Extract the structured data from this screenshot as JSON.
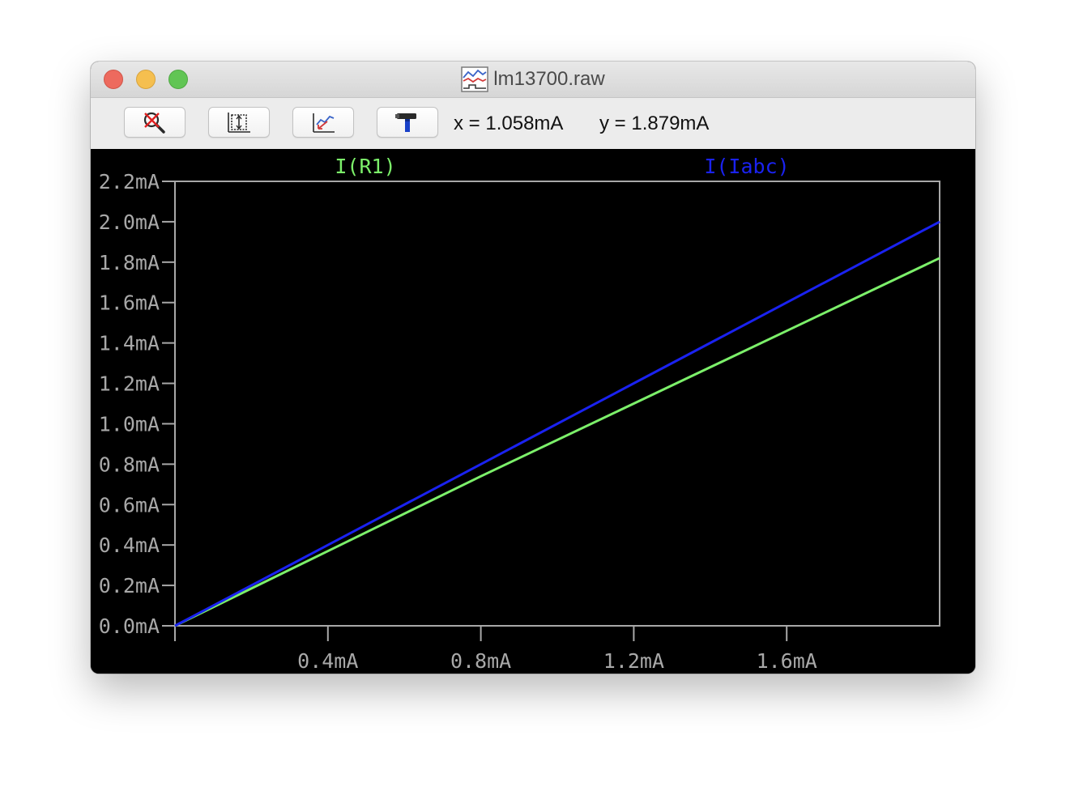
{
  "window": {
    "title": "lm13700.raw",
    "title_icon": "waveform-plot-icon"
  },
  "toolbar": {
    "buttons": [
      {
        "icon": "zoom-cancel-icon"
      },
      {
        "icon": "autorange-icon"
      },
      {
        "icon": "pan-icon"
      },
      {
        "icon": "settings-hammer-icon"
      }
    ],
    "cursor_x": "x = 1.058mA",
    "cursor_y": "y = 1.879mA"
  },
  "chart_data": {
    "type": "line",
    "title": "",
    "xlabel": "",
    "ylabel": "",
    "xlim": [
      0,
      2.0
    ],
    "ylim": [
      0,
      2.2
    ],
    "x_ticks": [
      "0.4mA",
      "0.8mA",
      "1.2mA",
      "1.6mA"
    ],
    "x_tick_values": [
      0.4,
      0.8,
      1.2,
      1.6
    ],
    "y_ticks": [
      "0.0mA",
      "0.2mA",
      "0.4mA",
      "0.6mA",
      "0.8mA",
      "1.0mA",
      "1.2mA",
      "1.4mA",
      "1.6mA",
      "1.8mA",
      "2.0mA",
      "2.2mA"
    ],
    "y_tick_values": [
      0.0,
      0.2,
      0.4,
      0.6,
      0.8,
      1.0,
      1.2,
      1.4,
      1.6,
      1.8,
      2.0,
      2.2
    ],
    "grid": false,
    "background": "#000000",
    "axis_color": "#a8a8a8",
    "series": [
      {
        "name": "I(R1)",
        "color": "#7cf06a",
        "x": [
          0,
          0.4,
          0.8,
          1.2,
          1.6,
          2.0
        ],
        "y": [
          0,
          0.37,
          0.74,
          1.1,
          1.46,
          1.82
        ]
      },
      {
        "name": "I(Iabc)",
        "color": "#1a22f0",
        "x": [
          0,
          0.4,
          0.8,
          1.2,
          1.6,
          2.0
        ],
        "y": [
          0,
          0.4,
          0.8,
          1.2,
          1.6,
          2.0
        ]
      }
    ]
  }
}
